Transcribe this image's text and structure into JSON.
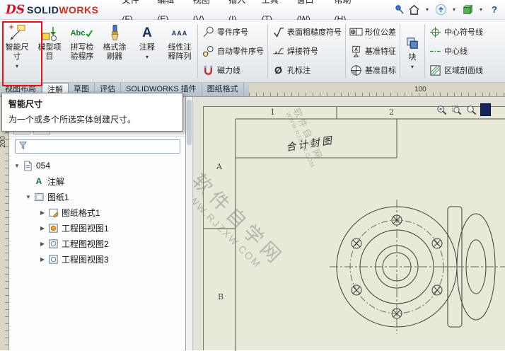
{
  "logo": {
    "ds": "DS",
    "solid": "SOLID",
    "works": "WORKS"
  },
  "menubar": {
    "items": [
      "文件(F)",
      "编辑(E)",
      "视图(V)",
      "插入(I)",
      "工具(T)",
      "窗口(W)",
      "帮助(H)"
    ]
  },
  "icons": {
    "dropdown": "▾",
    "panel_chevron": "›",
    "help": "?",
    "spell": "Abc",
    "note": "A",
    "linear": "AAA",
    "hole": "Ø",
    "annotation_a": "A",
    "tree_expanded": "▼",
    "tree_collapsed": "▶"
  },
  "ribbon": {
    "smart_dimension": {
      "l1": "智能尺",
      "l2": "寸"
    },
    "model_items": {
      "l1": "模型项",
      "l2": "目"
    },
    "spell_checker": {
      "l1": "拼写检",
      "l2": "验程序"
    },
    "format_painter": {
      "l1": "格式涂",
      "l2": "刷器"
    },
    "note": {
      "l1": "注释"
    },
    "linear_note_pattern": {
      "l1": "线性注",
      "l2": "释阵列"
    },
    "balloon": "零件序号",
    "auto_balloon": "自动零件序号",
    "magnetic_line": "磁力线",
    "surface_finish": "表面粗糙度符号",
    "weld_symbol": "焊接符号",
    "hole_callout": "孔标注",
    "geometric_tolerance": "形位公差",
    "datum_feature": "基准特征",
    "datum_target": "基准目标",
    "block": "块",
    "center_mark": "中心符号线",
    "centerline": "中心线",
    "area_hatch": "区域剖面线"
  },
  "tabs": {
    "items": [
      "视图布局",
      "注解",
      "草图",
      "评估",
      "SOLIDWORKS 插件",
      "图纸格式"
    ],
    "active": "注解"
  },
  "tooltip": {
    "title": "智能尺寸",
    "body": "为一个或多个所选实体创建尺寸。"
  },
  "panel": {
    "root": "054",
    "items": [
      "注解",
      "图纸1",
      "图纸格式1",
      "工程图视图1",
      "工程图视图2",
      "工程图视图3"
    ]
  },
  "rulers": {
    "h": "100",
    "v": "200"
  },
  "sheet": {
    "zone_col_1": "1",
    "zone_col_2": "2",
    "zone_row_a": "A",
    "zone_row_b": "B",
    "title_text": "合计封图"
  },
  "watermark": {
    "line1": "软件自学网",
    "line2": "WWW.RJZXW.COM"
  },
  "colors": {
    "accent_red": "#f01010",
    "sheet": "#e9e9da",
    "navy": "#17245c"
  }
}
